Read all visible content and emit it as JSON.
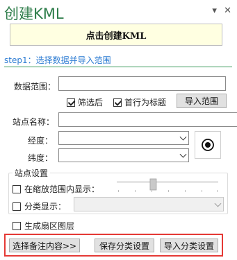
{
  "window": {
    "title": "创建KML",
    "dropdown_glyph": "▾",
    "close_glyph": "✕"
  },
  "create_button": {
    "label": "点击创建KML"
  },
  "step1": {
    "label": "step1：选择数据并导入范围"
  },
  "data_range": {
    "label": "数据范围：",
    "value": ""
  },
  "filter_checkbox": {
    "label": "筛选后",
    "checked": true
  },
  "header_checkbox": {
    "label": "首行为标题",
    "checked": true
  },
  "import_range_button": {
    "label": "导入范围"
  },
  "station_name": {
    "label": "站点名称：",
    "value": ""
  },
  "longitude": {
    "label": "经度：",
    "value": ""
  },
  "latitude": {
    "label": "纬度：",
    "value": ""
  },
  "station_settings": {
    "title": "站点设置",
    "zoom_show": {
      "label": "在缩放范围内显示：",
      "checked": false
    },
    "zoom_slider_fraction": 0.35,
    "category_show": {
      "label": "分类显示：",
      "checked": false
    }
  },
  "sector_layer": {
    "label": "生成扇区图层",
    "checked": false
  },
  "footer": {
    "choose_note_button": "选择备注内容>>",
    "save_category_button": "保存分类设置",
    "import_category_button": "导入分类设置"
  },
  "colors": {
    "accent_green": "#2e7d4a",
    "step_blue": "#2a7ad2",
    "highlight_red": "#e53935",
    "create_bg": "#ffffe1"
  },
  "icons": {
    "locate": "target-icon"
  }
}
